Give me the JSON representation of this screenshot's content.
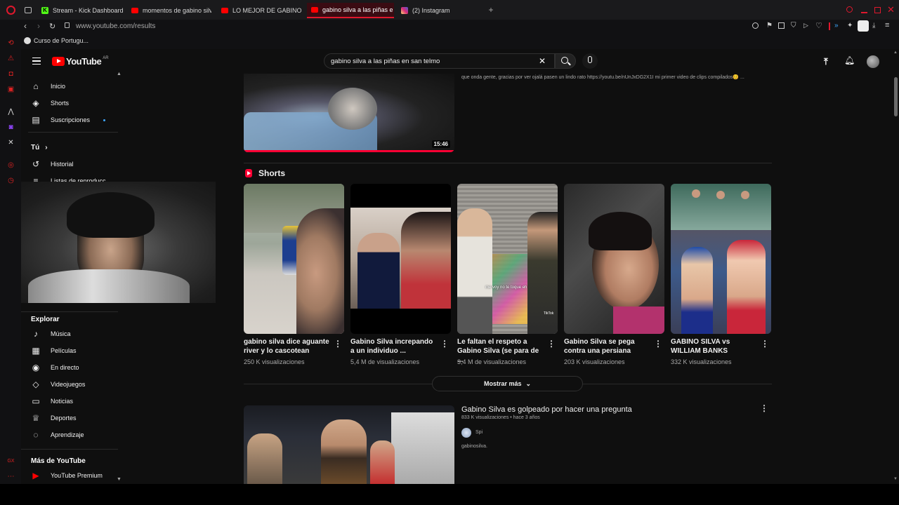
{
  "browser": {
    "tabs": [
      {
        "label": "Stream - Kick Dashboard",
        "icon": "kick-icon",
        "color": "#53fc18"
      },
      {
        "label": "momentos de gabino silv",
        "icon": "youtube-icon",
        "color": "#ff0000"
      },
      {
        "label": "LO MEJOR DE GABINO S",
        "icon": "youtube-icon",
        "color": "#ff0000"
      },
      {
        "label": "gabino silva a las piñas e",
        "icon": "youtube-icon",
        "color": "#ff0000"
      },
      {
        "label": "(2) Instagram",
        "icon": "instagram-icon",
        "color": "#e1306c"
      }
    ],
    "url": "www.youtube.com/results",
    "bookmark": "Curso de Portugu..."
  },
  "youtube": {
    "logo_text": "YouTube",
    "region": "AR",
    "search_value": "gabino silva a las piñas en san telmo",
    "sidebar": {
      "main": [
        {
          "label": "Inicio",
          "icon": "home-icon"
        },
        {
          "label": "Shorts",
          "icon": "shorts-icon"
        },
        {
          "label": "Suscripciones",
          "icon": "subscriptions-icon"
        }
      ],
      "you_label": "Tú",
      "you_items": [
        {
          "label": "Historial",
          "icon": "history-icon"
        },
        {
          "label": "Listas de reproducc",
          "icon": "playlist-icon"
        }
      ],
      "explore_title": "Explorar",
      "explore": [
        {
          "label": "Música",
          "icon": "music-icon"
        },
        {
          "label": "Películas",
          "icon": "movies-icon"
        },
        {
          "label": "En directo",
          "icon": "live-icon"
        },
        {
          "label": "Videojuegos",
          "icon": "gaming-icon"
        },
        {
          "label": "Noticias",
          "icon": "news-icon"
        },
        {
          "label": "Deportes",
          "icon": "trophy-icon"
        },
        {
          "label": "Aprendizaje",
          "icon": "learning-icon"
        }
      ],
      "more_title": "Más de YouTube",
      "premium": "YouTube Premium"
    },
    "top_video": {
      "description": "que onda gente, gracias por ver ojalá pasen un lindo rato https://youtu.be/nUnJxDG2X1I mi primer video de clips compilados😊 ...",
      "duration": "15:46"
    },
    "shorts_title": "Shorts",
    "shorts": [
      {
        "title": "gabino silva dice aguante river y lo cascotean",
        "views": "250 K visualizaciones"
      },
      {
        "title": "Gabino Silva increpando a un individuo ...",
        "views": "5,4 M de visualizaciones"
      },
      {
        "title": "Le faltan el respeto a Gabino Silva (se para de ...",
        "views": "3,4 M de visualizaciones"
      },
      {
        "title": "Gabino Silva se pega contra una persiana",
        "views": "203 K visualizaciones"
      },
      {
        "title": "GABINO SILVA vs WILLIAM BANKS",
        "views": "332 K visualizaciones"
      }
    ],
    "shorts_overlay_text": [
      "me voy no te toque eh",
      "TikTok"
    ],
    "show_more": "Mostrar más",
    "video2": {
      "title": "Gabino Silva es golpeado por hacer una pregunta",
      "meta": "833 K visualizaciones • hace 3 años",
      "channel": "Spi",
      "description": "gabinosilva."
    }
  }
}
